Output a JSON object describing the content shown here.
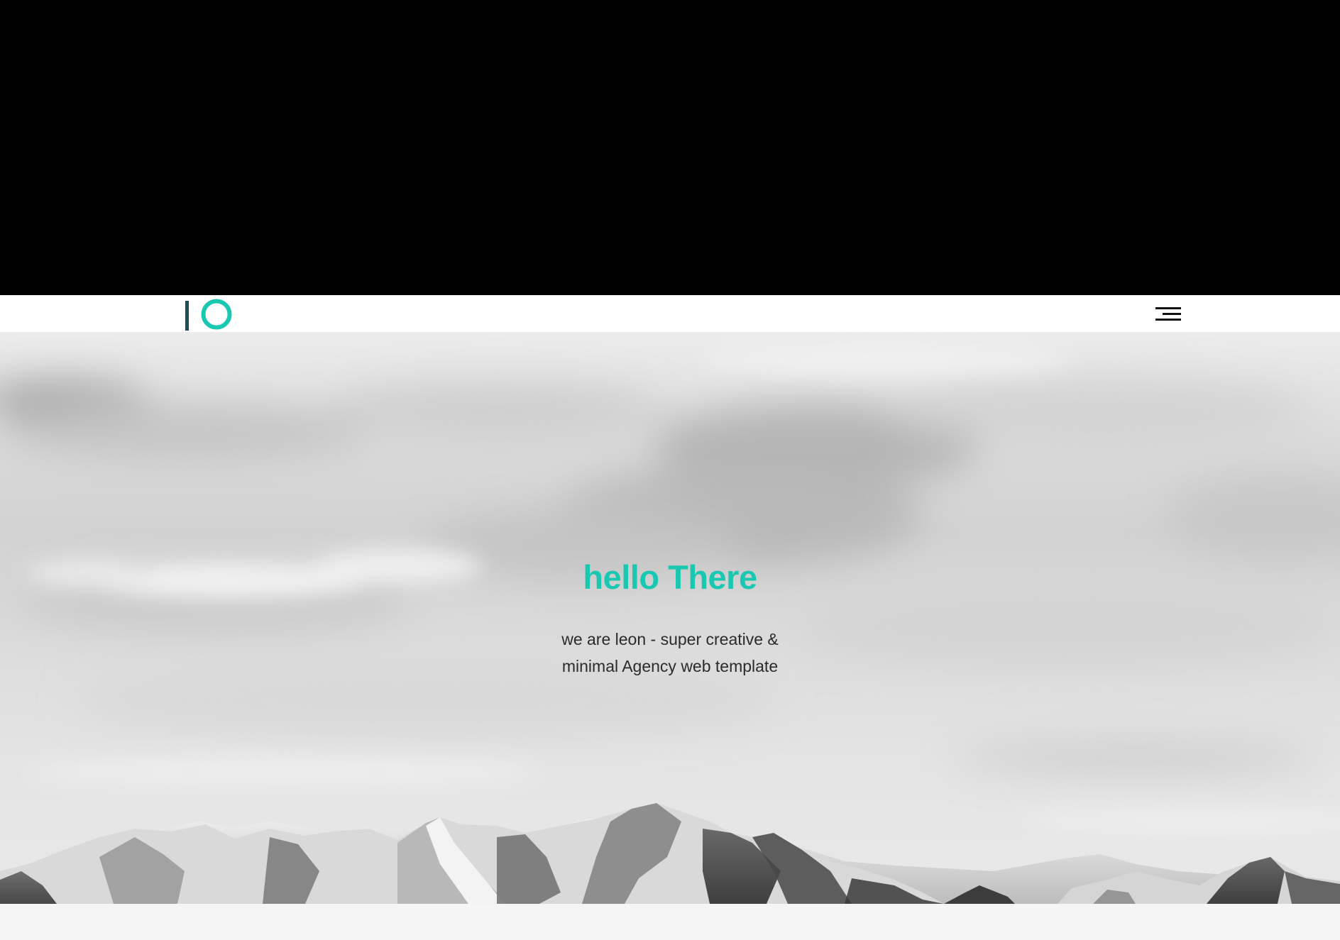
{
  "header": {
    "logo_icon": "logo-io-mark",
    "menu_icon": "hamburger-menu-icon"
  },
  "hero": {
    "title": "hello There",
    "subtitle_line1": "we are leon - super creative &",
    "subtitle_line2": "minimal Agency web template"
  },
  "colors": {
    "accent": "#1ac7b0",
    "logo_bar": "#1e4d5c",
    "text_dark": "#2b2b2b",
    "navbar_bg": "#ffffff",
    "top_area_bg": "#000000",
    "below_hero_bg": "#f5f5f5"
  }
}
